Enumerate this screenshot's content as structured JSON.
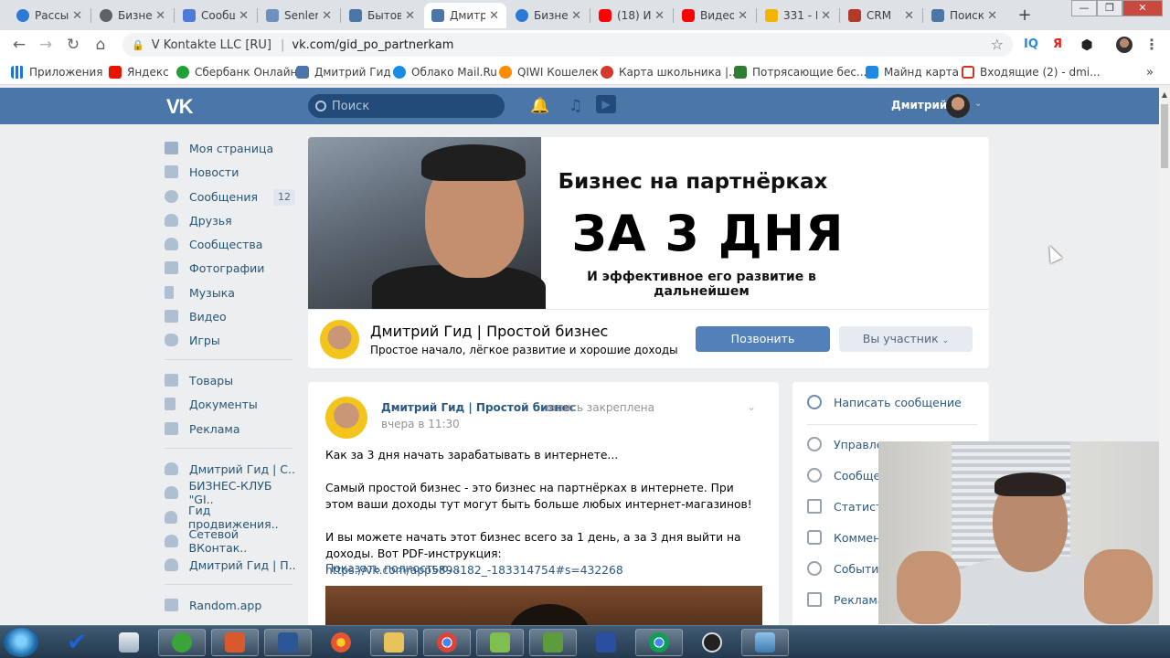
{
  "browser": {
    "tabs": [
      {
        "title": "Рассы",
        "icon": "chrome-ext-icon"
      },
      {
        "title": "Бизне",
        "icon": "globe-icon"
      },
      {
        "title": "Сообщ",
        "icon": "message-icon"
      },
      {
        "title": "Senler",
        "icon": "mail-icon"
      },
      {
        "title": "Бытов",
        "icon": "vk-icon"
      },
      {
        "title": "Дмитр",
        "icon": "vk-icon"
      },
      {
        "title": "Бизне",
        "icon": "chrome-ext-icon"
      },
      {
        "title": "(18) И",
        "icon": "youtube-icon"
      },
      {
        "title": "Видео",
        "icon": "youtube-icon"
      },
      {
        "title": "331 - E",
        "icon": "gmail-icon"
      },
      {
        "title": "CRM",
        "icon": "crm-icon"
      },
      {
        "title": "Поиск",
        "icon": "vk-icon"
      }
    ],
    "active_tab_index": 5,
    "url_site_identity": "V Kontakte LLC [RU]",
    "url": "vk.com/gid_po_partnerkam",
    "extensions": [
      "IQ",
      "Я"
    ],
    "bookmarks": [
      {
        "label": "Приложения",
        "color": "#1a73e8"
      },
      {
        "label": "Яндекс",
        "color": "#e61400"
      },
      {
        "label": "Сбербанк Онлайн",
        "color": "#21a038"
      },
      {
        "label": "Дмитрий Гид",
        "color": "#4a76a8"
      },
      {
        "label": "Облако Mail.Ru",
        "color": "#168de2"
      },
      {
        "label": "QIWI Кошелек",
        "color": "#ff8c00"
      },
      {
        "label": "Карта школьника |...",
        "color": "#d33a2c"
      },
      {
        "label": "Потрясающие бес...",
        "color": "#2e7d32"
      },
      {
        "label": "Майнд карта",
        "color": "#1e88e5"
      },
      {
        "label": "Входящие (2) - dmi...",
        "color": "#d93025"
      }
    ]
  },
  "vk": {
    "logo": "VK",
    "search_placeholder": "Поиск",
    "user_name": "Дмитрий",
    "brand_color": "#4a76a8",
    "menu": [
      {
        "label": "Моя страница",
        "icon": "home-icon"
      },
      {
        "label": "Новости",
        "icon": "news-icon"
      },
      {
        "label": "Сообщения",
        "icon": "messages-icon",
        "badge": "12"
      },
      {
        "label": "Друзья",
        "icon": "friends-icon"
      },
      {
        "label": "Сообщества",
        "icon": "communities-icon"
      },
      {
        "label": "Фотографии",
        "icon": "camera-icon"
      },
      {
        "label": "Музыка",
        "icon": "music-icon"
      },
      {
        "label": "Видео",
        "icon": "video-icon"
      },
      {
        "label": "Игры",
        "icon": "gamepad-icon"
      }
    ],
    "menu2": [
      {
        "label": "Товары",
        "icon": "bag-icon"
      },
      {
        "label": "Документы",
        "icon": "document-icon"
      },
      {
        "label": "Реклама",
        "icon": "megaphone-icon"
      }
    ],
    "menu3": [
      {
        "label": "Дмитрий Гид | С..",
        "icon": "group-icon"
      },
      {
        "label": "БИЗНЕС-КЛУБ \"GI..",
        "icon": "group-icon"
      },
      {
        "label": "Гид продвижения..",
        "icon": "group-icon"
      },
      {
        "label": "Сетевой ВКонтак..",
        "icon": "group-icon"
      },
      {
        "label": "Дмитрий Гид | П..",
        "icon": "group-icon"
      }
    ],
    "menu4": [
      {
        "label": "Random.app",
        "icon": "app-icon"
      }
    ]
  },
  "cover": {
    "line1": "Бизнес на партнёрках",
    "line2": "ЗА 3 ДНЯ",
    "line3": "И эффективное его развитие в дальнейшем"
  },
  "group": {
    "name": "Дмитрий Гид | Простой бизнес",
    "status": "Простое начало, лёгкое развитие и хорошие доходы",
    "call_button": "Позвонить",
    "member_button": "Вы участник"
  },
  "post": {
    "author": "Дмитрий Гид | Простой бизнес",
    "pinned": "запись закреплена",
    "date": "вчера в 11:30",
    "p1": "Как за 3 дня начать зарабатывать в интернете...",
    "p2": "Самый простой бизнес - это бизнес на партнёрках в интернете. При этом ваши доходы тут могут быть больше любых интернет-магазинов!",
    "p3": "И вы можете начать этот бизнес всего за 1 день, а за 3 дня выйти на доходы. Вот PDF-инструкция:",
    "link": "https://vk.com/app5898182_-183314754#s=432268",
    "more": "Показать полностью..."
  },
  "actions": [
    {
      "label": "Написать сообщение",
      "icon": "message-circle-icon"
    },
    {
      "label": "Управле",
      "icon": "gear-icon"
    },
    {
      "label": "Сообщен",
      "icon": "chat-icon"
    },
    {
      "label": "Статисти",
      "icon": "stats-icon"
    },
    {
      "label": "Коммент",
      "icon": "comment-icon"
    },
    {
      "label": "События",
      "icon": "events-icon"
    },
    {
      "label": "Реклама",
      "icon": "megaphone-icon"
    }
  ]
}
